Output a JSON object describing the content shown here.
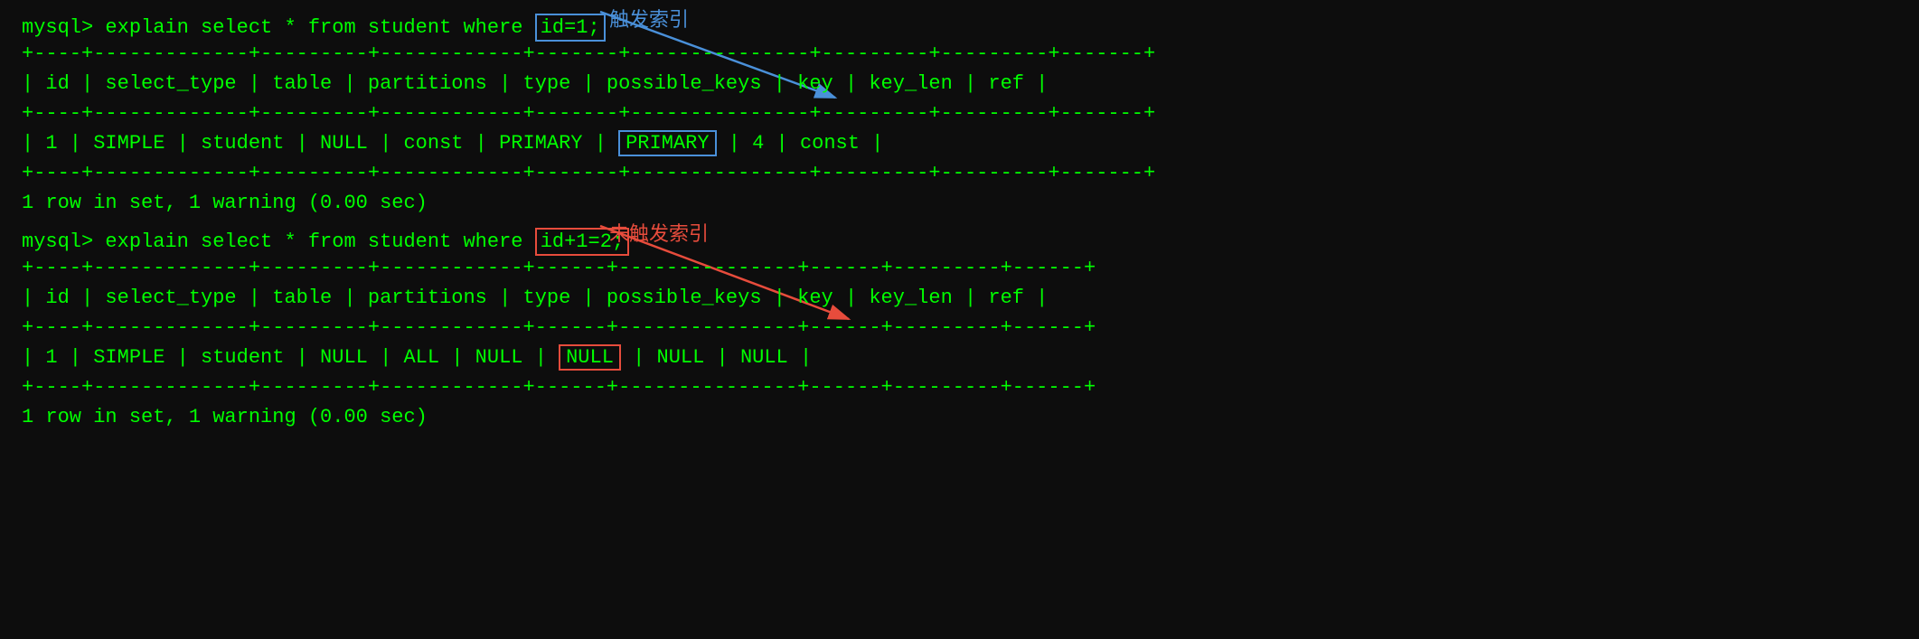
{
  "section1": {
    "prompt": "mysql> explain select * from student where ",
    "condition": "id=1;",
    "annotation": "触发索引",
    "separator_line": "+----+-------------+---------+------------+-------+---------------+---------+---------+-------+",
    "header_line": "| id | select_type | table   | partitions | type  | possible_keys | key     | key_len | ref   |",
    "data_line": "|  1 | SIMPLE      | student | NULL       | const | PRIMARY       | PRIMARY | 4       | const |",
    "status": "1 row in set, 1 warning (0.00 sec)"
  },
  "section2": {
    "prompt": "mysql> explain select * from student where ",
    "condition": "id+1=2;",
    "annotation": "未触发索引",
    "separator_line": "+----+-------------+---------+------------+------+---------------+------+---------+------+",
    "header_line": "| id | select_type | table   | partitions | type | possible_keys | key  | key_len | ref  |",
    "data_line": "|  1 | SIMPLE      | student | NULL       | ALL  | NULL          | NULL | NULL    | NULL |",
    "status": "1 row in set, 1 warning (0.00 sec)"
  }
}
